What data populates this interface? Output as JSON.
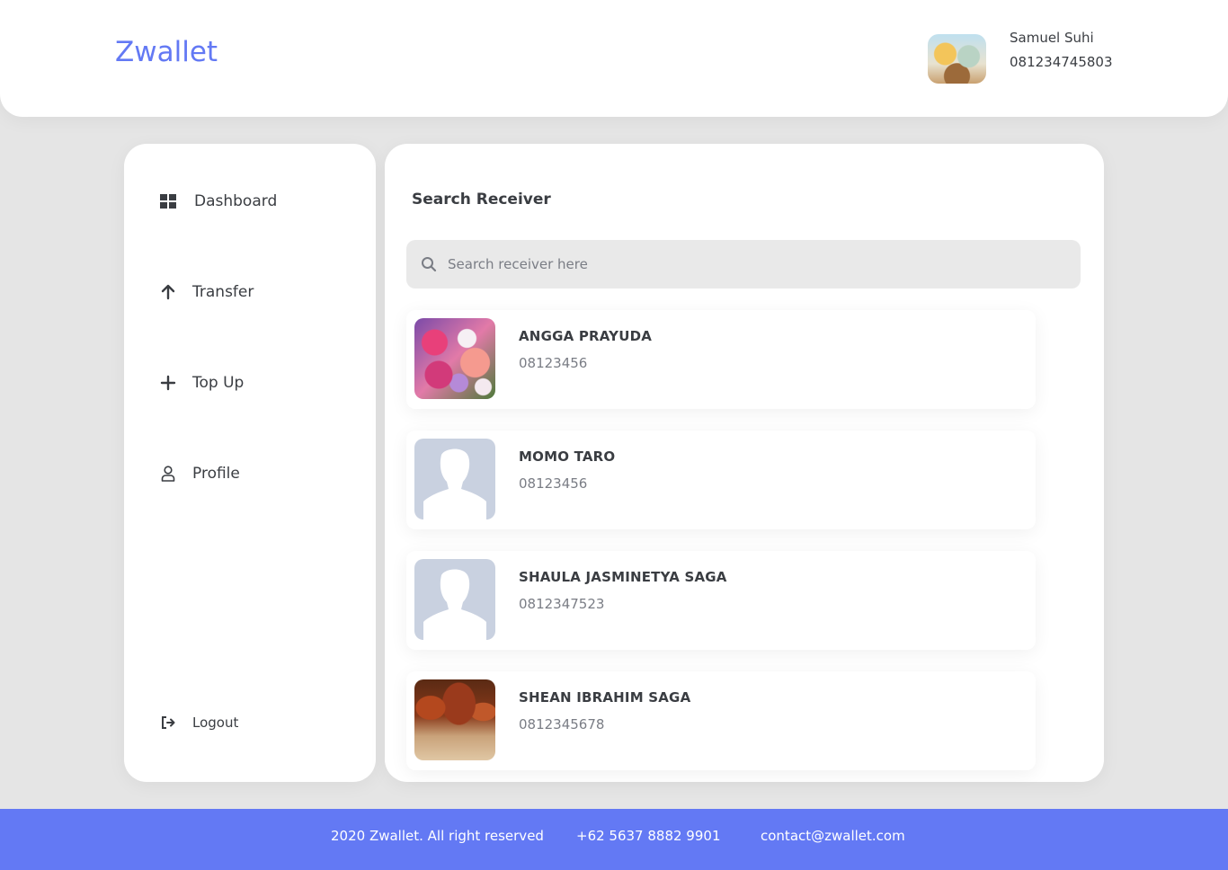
{
  "header": {
    "brand": "Zwallet",
    "user": {
      "name": "Samuel Suhi",
      "phone": "081234745803"
    }
  },
  "sidebar": {
    "items": [
      {
        "label": "Dashboard",
        "icon": "grid-icon"
      },
      {
        "label": "Transfer",
        "icon": "arrow-up-icon"
      },
      {
        "label": "Top Up",
        "icon": "plus-icon"
      },
      {
        "label": "Profile",
        "icon": "user-icon"
      }
    ],
    "logout": {
      "label": "Logout",
      "icon": "logout-icon"
    }
  },
  "main": {
    "title": "Search Receiver",
    "search": {
      "placeholder": "Search receiver here",
      "value": ""
    },
    "receivers": [
      {
        "name": "ANGGA PRAYUDA",
        "phone": "08123456",
        "avatar": "flowers-photo"
      },
      {
        "name": "MOMO TARO",
        "phone": "08123456",
        "avatar": "default-avatar"
      },
      {
        "name": "SHAULA JASMINETYA SAGA",
        "phone": "0812347523",
        "avatar": "default-avatar"
      },
      {
        "name": "SHEAN IBRAHIM SAGA",
        "phone": "0812345678",
        "avatar": "autumn-trees-photo"
      }
    ]
  },
  "footer": {
    "copyright": "2020 Zwallet. All right reserved",
    "phone": "+62 5637 8882 9901",
    "email": "contact@zwallet.com"
  },
  "colors": {
    "brand": "#6379f4",
    "background": "#e5e5e5",
    "text": "#3a3d42",
    "muted": "#7a7d85"
  }
}
